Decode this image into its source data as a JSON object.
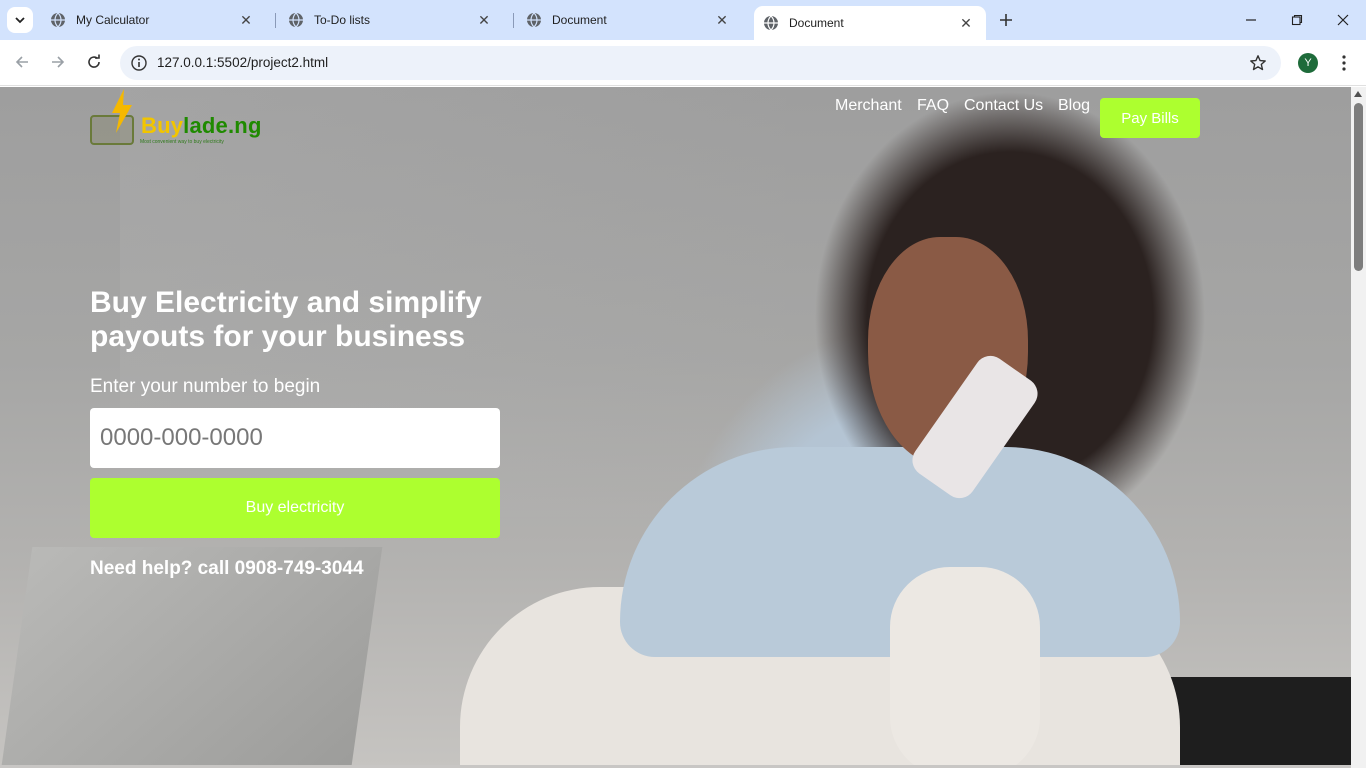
{
  "browser": {
    "tabs": [
      {
        "title": "My Calculator",
        "active": false
      },
      {
        "title": "To-Do lists",
        "active": false
      },
      {
        "title": "Document",
        "active": false
      },
      {
        "title": "Document",
        "active": true
      }
    ],
    "url": "127.0.0.1:5502/project2.html",
    "profile_initial": "Y",
    "colors": {
      "tabbar": "#d3e3fd",
      "omnibox": "#edf2fa",
      "profile": "#1e6b3a"
    }
  },
  "site": {
    "logo": {
      "brand_part1": "Buy",
      "brand_part2": "lade.ng",
      "tagline": "Most convenient way to buy electricity"
    },
    "nav": [
      {
        "label": "Merchant"
      },
      {
        "label": "FAQ"
      },
      {
        "label": "Contact Us"
      },
      {
        "label": "Blog"
      }
    ],
    "pay_bills_label": "Pay Bills",
    "hero": {
      "title": "Buy Electricity and simplify payouts for your business",
      "prompt": "Enter your number to begin",
      "phone_placeholder": "0000-000-0000",
      "buy_button_label": "Buy electricity",
      "help_text": "Need help? call 0908-749-3044"
    },
    "colors": {
      "accent": "#adff2f",
      "brand_yellow": "#f2c500",
      "brand_green": "#1f8a00"
    }
  }
}
